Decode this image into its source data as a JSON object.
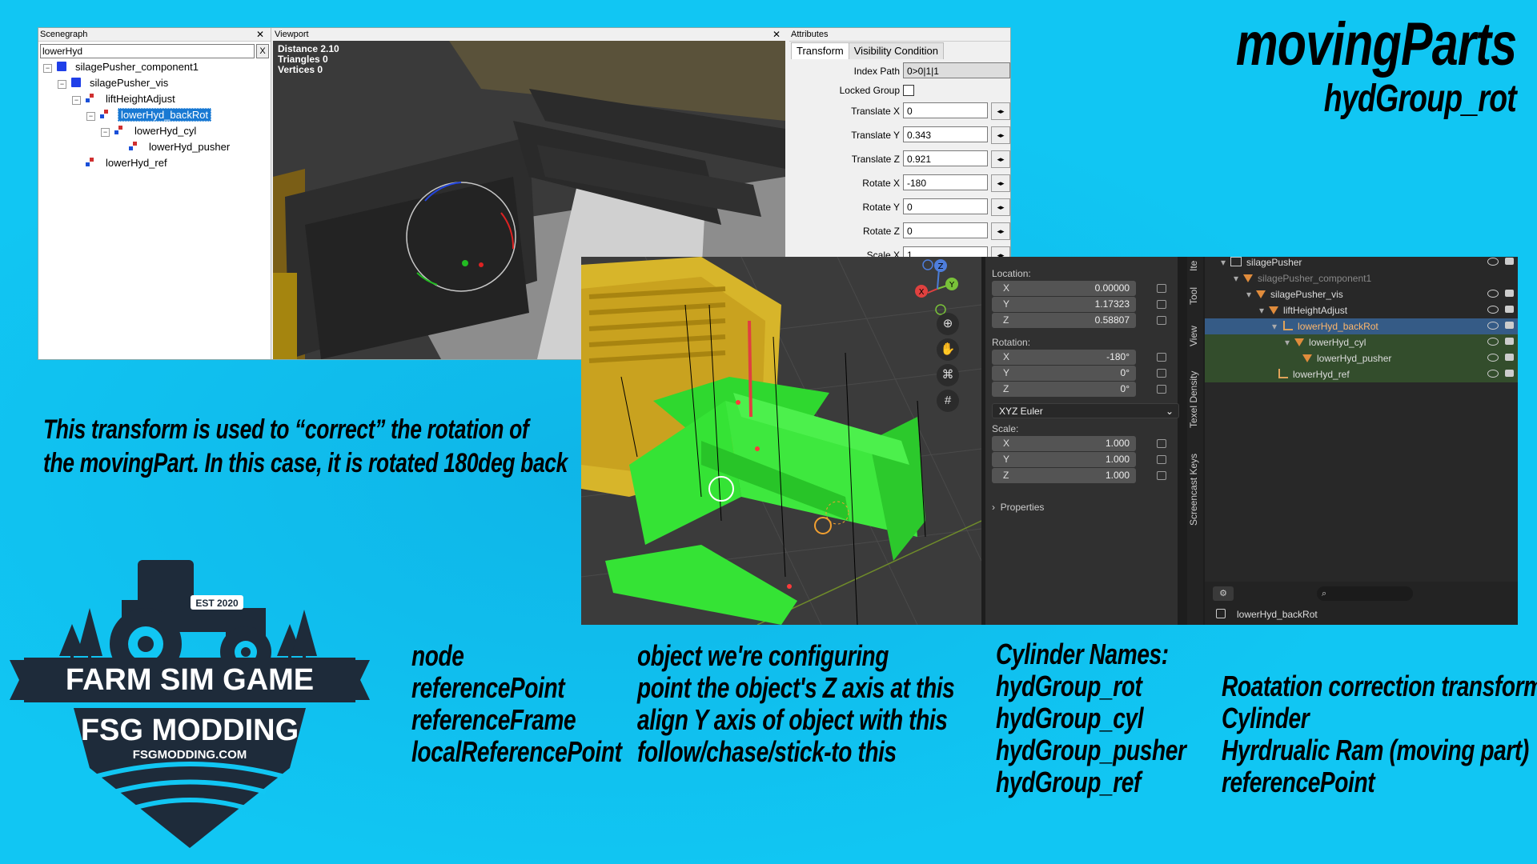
{
  "headline": {
    "title": "movingParts",
    "subtitle": "hydGroup_rot"
  },
  "description": {
    "line1": "This transform is used to “correct” the rotation of",
    "line2": "the movingPart. In this case, it is rotated 180deg back"
  },
  "giants_editor": {
    "scenegraph": {
      "title": "Scenegraph",
      "search_value": "lowerHyd",
      "clear_label": "X",
      "nodes": [
        {
          "label": "silagePusher_component1",
          "icon": "cube-icon",
          "depth": 0
        },
        {
          "label": "silagePusher_vis",
          "icon": "cube-icon",
          "depth": 1
        },
        {
          "label": "liftHeightAdjust",
          "icon": "transform-group-icon",
          "depth": 2
        },
        {
          "label": "lowerHyd_backRot",
          "icon": "transform-group-icon",
          "depth": 3,
          "selected": true
        },
        {
          "label": "lowerHyd_cyl",
          "icon": "transform-group-icon",
          "depth": 4
        },
        {
          "label": "lowerHyd_pusher",
          "icon": "transform-group-icon",
          "depth": 5
        },
        {
          "label": "lowerHyd_ref",
          "icon": "transform-group-icon",
          "depth": 2
        }
      ]
    },
    "viewport": {
      "title": "Viewport",
      "stats": [
        "Distance 2.10",
        "Triangles 0",
        "Vertices 0"
      ]
    },
    "attributes": {
      "title": "Attributes",
      "tabs": [
        "Transform",
        "Visibility Condition"
      ],
      "index_path_label": "Index Path",
      "index_path_value": "0>0|1|1",
      "locked_group_label": "Locked Group",
      "fields": [
        {
          "label": "Translate X",
          "value": "0"
        },
        {
          "label": "Translate Y",
          "value": "0.343"
        },
        {
          "label": "Translate Z",
          "value": "0.921"
        },
        {
          "label": "Rotate X",
          "value": "-180"
        },
        {
          "label": "Rotate Y",
          "value": "0"
        },
        {
          "label": "Rotate Z",
          "value": "0"
        },
        {
          "label": "Scale X",
          "value": "1"
        }
      ]
    }
  },
  "blender": {
    "properties": {
      "location_label": "Location:",
      "location": [
        {
          "axis": "X",
          "value": "0.00000"
        },
        {
          "axis": "Y",
          "value": "1.17323"
        },
        {
          "axis": "Z",
          "value": "0.58807"
        }
      ],
      "rotation_label": "Rotation:",
      "rotation": [
        {
          "axis": "X",
          "value": "-180°"
        },
        {
          "axis": "Y",
          "value": "0°"
        },
        {
          "axis": "Z",
          "value": "0°"
        }
      ],
      "rotation_mode": "XYZ Euler",
      "scale_label": "Scale:",
      "scale": [
        {
          "axis": "X",
          "value": "1.000"
        },
        {
          "axis": "Y",
          "value": "1.000"
        },
        {
          "axis": "Z",
          "value": "1.000"
        }
      ],
      "properties_label": "Properties"
    },
    "gizmo_axes": {
      "x": "X",
      "y": "Y",
      "z": "Z"
    },
    "side_tabs": [
      "Ite",
      "Tool",
      "View",
      "Texel Density",
      "Screencast Keys"
    ],
    "outliner": [
      {
        "label": "silagePusher",
        "depth": 0
      },
      {
        "label": "silagePusher_component1",
        "depth": 1
      },
      {
        "label": "silagePusher_vis",
        "depth": 2
      },
      {
        "label": "liftHeightAdjust",
        "depth": 3
      },
      {
        "label": "lowerHyd_backRot",
        "depth": 4
      },
      {
        "label": "lowerHyd_cyl",
        "depth": 5
      },
      {
        "label": "lowerHyd_pusher",
        "depth": 6
      },
      {
        "label": "lowerHyd_ref",
        "depth": 4
      }
    ],
    "footer_label": "lowerHyd_backRot"
  },
  "legend": {
    "col1": [
      "node",
      "referencePoint",
      "referenceFrame",
      "localReferencePoint"
    ],
    "col2": [
      "object we're configuring",
      "point the object's Z axis at this",
      "align Y axis of object with this",
      "follow/chase/stick-to this"
    ],
    "col3_title": "Cylinder Names:",
    "col3": [
      "hydGroup_rot",
      "hydGroup_cyl",
      "hydGroup_pusher",
      "hydGroup_ref"
    ],
    "col4": [
      "Roatation correction transform",
      "Cylinder",
      "Hyrdrualic Ram (moving part)",
      "referencePoint"
    ]
  },
  "logo": {
    "est": "EST 2020",
    "banner": "FARM SIM GAME",
    "brand": "FSG MODDING",
    "url": "FSGMODDING.COM"
  }
}
